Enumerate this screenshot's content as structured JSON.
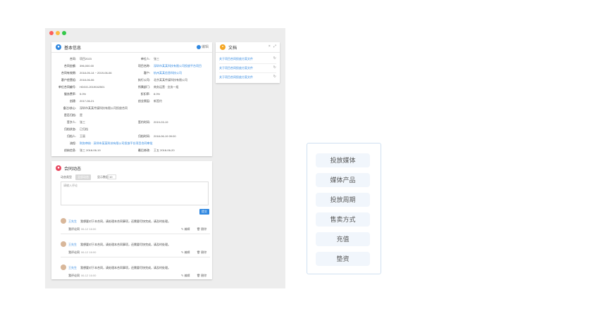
{
  "basic_info": {
    "title": "基本信息",
    "edit_label": "编辑",
    "rows": [
      {
        "l1": "合同:",
        "v1": "项目2023",
        "l2": "单位人:",
        "v2": "张三",
        "link1": false,
        "link2": false
      },
      {
        "l1": "合同金额:",
        "v1": "396,000.00",
        "l2": "项目名称:",
        "v2": "深圳市某某科技有限公司投放平台项目",
        "link1": false,
        "link2": true
      },
      {
        "l1": "合同有效期:",
        "v1": "2018-05-14 ~ 2019-06-06",
        "l2": "客户:",
        "v2": "杭州某某信息科技公司",
        "link1": false,
        "link2": true
      },
      {
        "l1": "客户经营组:",
        "v1": "2018-06-06",
        "l2": "执行公司:",
        "v2": "北京某某传媒科技有限公司",
        "link1": false,
        "link2": false
      },
      {
        "l1": "单位合同编号:",
        "v1": "HDGG-2019042501",
        "l2": "所属部门:",
        "v2": "商务运营 · 业务一组",
        "link1": false,
        "link2": false
      },
      {
        "l1": "服务费率:",
        "v1": "5.0%",
        "l2": "折扣率:",
        "v2": "8.0%",
        "link1": false,
        "link2": false
      },
      {
        "l1": "创建:",
        "v1": "2017-06-21",
        "l2": "创业原因:",
        "v2": "新签约",
        "link1": false,
        "link2": false
      },
      {
        "l1": "备注/核心:",
        "v1": "深圳市某某传媒科技有限公司投放合同",
        "l2": "",
        "v2": "",
        "link1": false,
        "link2": false
      },
      {
        "l1": "是否归档:",
        "v1": "是",
        "l2": "",
        "v2": "",
        "link1": false,
        "link2": false
      },
      {
        "l1": "签字人:",
        "v1": "张三",
        "l2": "签约时间:",
        "v2": "2019-03-19",
        "link1": false,
        "link2": false
      },
      {
        "l1": "归档状态:",
        "v1": "已归档",
        "l2": "",
        "v2": "",
        "link1": false,
        "link2": false
      },
      {
        "l1": "归档人:",
        "v1": "王丽",
        "l2": "归档时间:",
        "v2": "2018-06-19 09:00",
        "link1": false,
        "link2": false
      },
      {
        "l1": "流程:",
        "v1": "财务审核 · 深圳市某某科技有限公司投放平台项目合同审批",
        "l2": "",
        "v2": "",
        "link1": true,
        "link2": false
      },
      {
        "l1": "创始信息:",
        "v1": "张三 2018-06-19",
        "l2": "最后修改:",
        "v2": "王五 2018-06-20",
        "link1": false,
        "link2": false
      }
    ]
  },
  "docs": {
    "title": "文档",
    "close_icon": "×",
    "expand_icon": "⤢",
    "items": [
      "关于项目合同投放方案文件",
      "关于项目合同投放方案文件",
      "关于项目合同投放方案文件"
    ]
  },
  "activity": {
    "title": "合同动态",
    "tag_label": "动态类型",
    "tag_value": "全部动态",
    "filter_label": "显示数量",
    "filter_value": "10",
    "placeholder": "请输入评论",
    "submit_label": "提交",
    "comments": [
      {
        "user": "王先生",
        "text": "我想要对于本合同，请处理本合同事项，还需要尽快完成，请及时处理。",
        "sub": "我评论同",
        "time": "06-12 16:00",
        "edit": "编辑",
        "del": "删除"
      },
      {
        "user": "王先生",
        "text": "我想要对于本合同，请处理本合同事项，还需要尽快完成，请及时处理。",
        "sub": "我评论同",
        "time": "06-12 16:00",
        "edit": "编辑",
        "del": "删除"
      },
      {
        "user": "王先生",
        "text": "我想要对于本合同，请处理本合同事项，还需要尽快完成，请及时处理。",
        "sub": "我评论同",
        "time": "06-12 16:00",
        "edit": "编辑",
        "del": "删除"
      }
    ]
  },
  "menu": {
    "items": [
      "投放媒体",
      "媒体产品",
      "投放周期",
      "售卖方式",
      "充值",
      "垫资"
    ]
  },
  "colors": {
    "accent": "#2f87e0",
    "info_icon": "#2f87e0",
    "doc_icon": "#f5a623",
    "activity_icon": "#e8475f"
  }
}
